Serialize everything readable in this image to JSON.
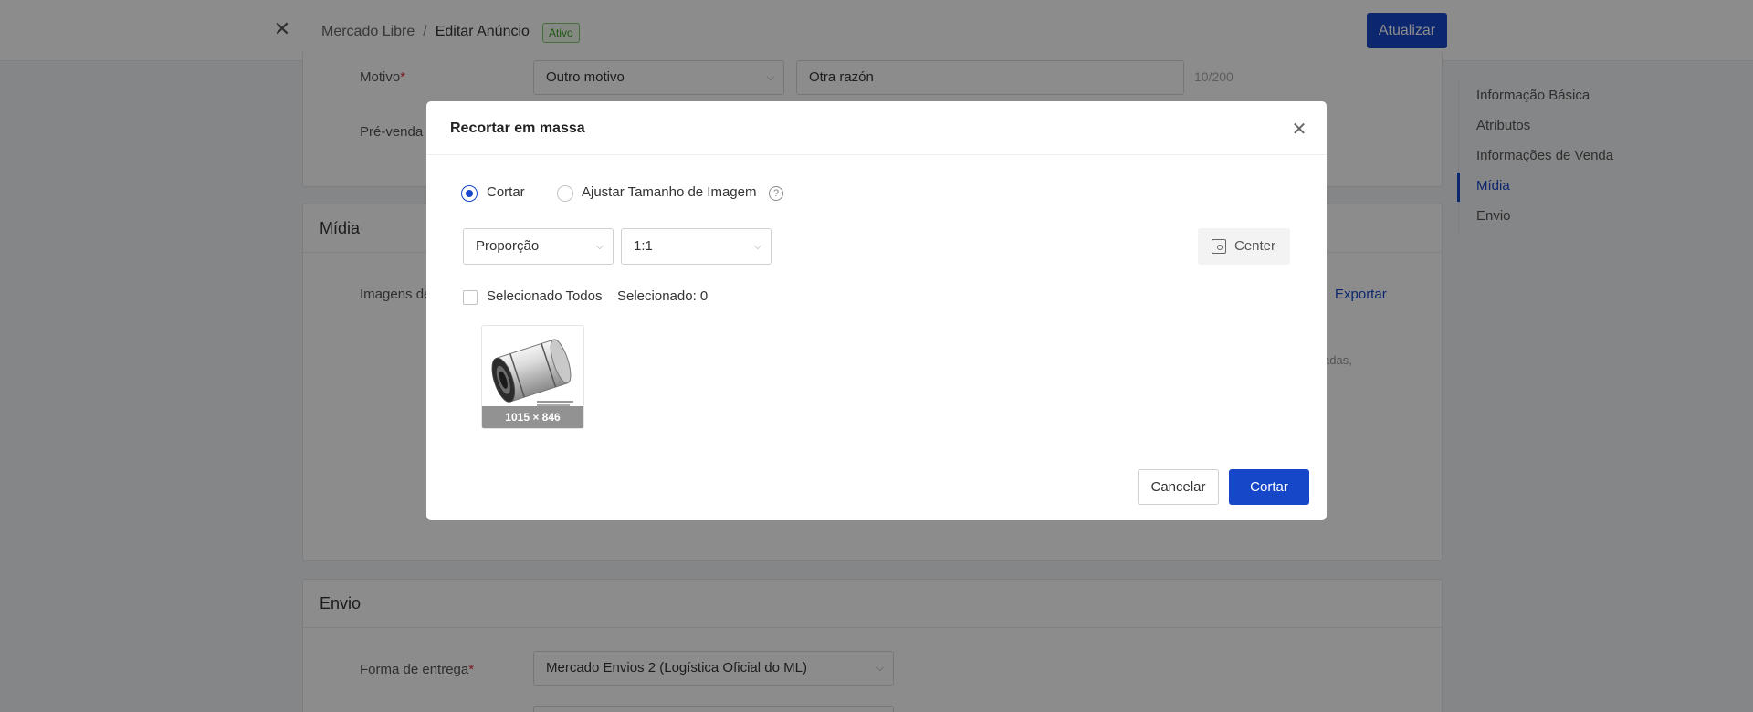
{
  "topbar": {
    "close_icon": "close-icon",
    "breadcrumb_root": "Mercado Libre",
    "breadcrumb_separator": "/",
    "breadcrumb_current": "Editar Anúncio",
    "status_badge": "Ativo",
    "update_button": "Atualizar"
  },
  "form": {
    "motivo_label": "Motivo",
    "required_mark": "*",
    "motivo_value": "Outro motivo",
    "motivo_reason_value": "Otra razón",
    "motivo_counter": "10/200",
    "prevenda_label": "Pré-venda"
  },
  "midia": {
    "section_title": "Mídia",
    "images_label": "Imagens de",
    "export_link": "Exportar",
    "hint_fragment": "adas,"
  },
  "envio": {
    "section_title": "Envio",
    "delivery_label": "Forma de entrega",
    "delivery_value": "Mercado Envios 2 (Logística Oficial do ML)"
  },
  "side_nav": {
    "items": [
      {
        "label": "Informação Básica",
        "active": false
      },
      {
        "label": "Atributos",
        "active": false
      },
      {
        "label": "Informações de Venda",
        "active": false
      },
      {
        "label": "Mídia",
        "active": true
      },
      {
        "label": "Envio",
        "active": false
      }
    ]
  },
  "modal": {
    "title": "Recortar em massa",
    "mode_options": [
      {
        "label": "Cortar",
        "selected": true
      },
      {
        "label": "Ajustar Tamanho de Imagem",
        "selected": false
      }
    ],
    "help_icon": "question-circle-icon",
    "ratio_type_value": "Proporção",
    "ratio_value": "1:1",
    "center_button": "Center",
    "select_all_label": "Selecionado Todos",
    "selected_count_label": "Selecionado: 0",
    "image_size": "1015 × 846",
    "cancel_button": "Cancelar",
    "confirm_button": "Cortar"
  },
  "colors": {
    "primary": "#1747c9",
    "success": "#3f9d2c",
    "required": "#e0303a"
  }
}
